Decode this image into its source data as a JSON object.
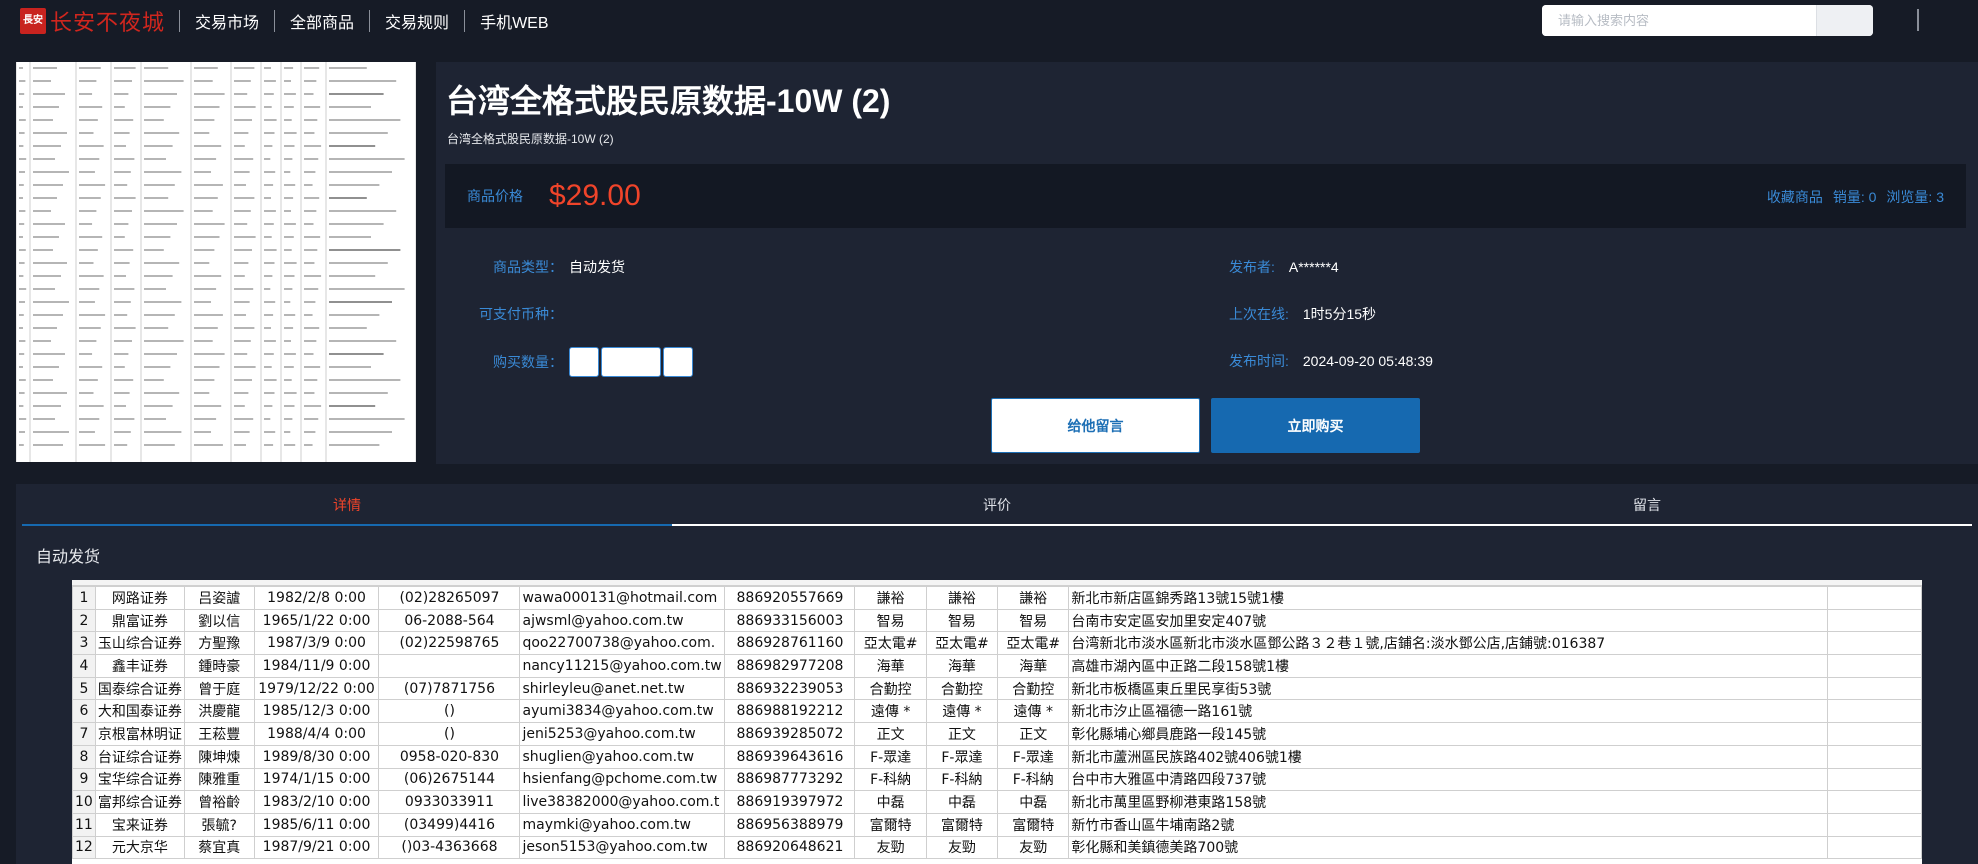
{
  "nav": {
    "logo_mark": "長安",
    "logo_text": "长安不夜城",
    "links": [
      "交易市场",
      "全部商品",
      "交易规则",
      "手机WEB"
    ],
    "search_placeholder": "请输入搜索内容"
  },
  "product": {
    "title": "台湾全格式股民原数据-10W (2)",
    "subtitle": "台湾全格式股民原数据-10W (2)",
    "price_label": "商品价格",
    "price": "$29.00",
    "fav_label": "收藏商品",
    "sales": "销量: 0",
    "views": "浏览量: 3",
    "type_label": "商品类型：",
    "type_value": "自动发货",
    "currency_label": "可支付币种：",
    "qty_label": "购买数量：",
    "publisher_label": "发布者:",
    "publisher_value": "A******4",
    "online_label": "上次在线:",
    "online_value": "1时5分15秒",
    "time_label": "发布时间:",
    "time_value": "2024-09-20 05:48:39",
    "msg_button": "给他留言",
    "buy_button": "立即购买"
  },
  "tabs": [
    "详情",
    "评价",
    "留言"
  ],
  "detail": {
    "section_title": "自动发货",
    "rows": [
      [
        "1",
        "网路证券",
        "吕姿謯",
        "1982/2/8 0:00",
        "(02)28265097",
        "wawa000131@hotmail.com",
        "886920557669",
        "謙裕",
        "謙裕",
        "謙裕",
        "新北市新店區錦秀路13號15號1樓"
      ],
      [
        "2",
        "鼎富证券",
        "劉以信",
        "1965/1/22 0:00",
        "06-2088-564",
        "ajwsml@yahoo.com.tw",
        "886933156003",
        "智易",
        "智易",
        "智易",
        "台南市安定區安加里安定407號"
      ],
      [
        "3",
        "玉山综合证券",
        "方聖豫",
        "1987/3/9 0:00",
        "(02)22598765",
        "qoo22700738@yahoo.com.",
        "886928761160",
        "亞太電#",
        "亞太電#",
        "亞太電#",
        "台湾新北市淡水區新北市淡水區鄧公路３２巷１號,店鋪名:淡水鄧公店,店鋪號:016387"
      ],
      [
        "4",
        "鑫丰证券",
        "鍾時豪",
        "1984/11/9 0:00",
        "",
        "nancy11215@yahoo.com.tw",
        "886982977208",
        "海華",
        "海華",
        "海華",
        "高雄市湖內區中正路二段158號1樓"
      ],
      [
        "5",
        "国泰综合证券",
        "曾于庭",
        "1979/12/22 0:00",
        "(07)7871756",
        "shirleyleu@anet.net.tw",
        "886932239053",
        "合勤控",
        "合勤控",
        "合勤控",
        "新北市板橋區東丘里民享街53號"
      ],
      [
        "6",
        "大和国泰证券",
        "洪慶龍",
        "1985/12/3 0:00",
        "()",
        "ayumi3834@yahoo.com.tw",
        "886988192212",
        "遠傳 *",
        "遠傳 *",
        "遠傳 *",
        "新北市汐止區福德一路161號"
      ],
      [
        "7",
        "京根富林明证",
        "王菘豐",
        "1988/4/4 0:00",
        "()",
        "jeni5253@yahoo.com.tw",
        "886939285072",
        "正文",
        "正文",
        "正文",
        "彰化縣埔心鄉員鹿路一段145號"
      ],
      [
        "8",
        "台证综合证券",
        "陳坤煉",
        "1989/8/30 0:00",
        "0958-020-830",
        "shuglien@yahoo.com.tw",
        "886939643616",
        "F-眾達",
        "F-眾達",
        "F-眾達",
        "新北市蘆洲區民族路402號406號1樓"
      ],
      [
        "9",
        "宝华综合证券",
        "陳雅重",
        "1974/1/15 0:00",
        "(06)2675144",
        "hsienfang@pchome.com.tw",
        "886987773292",
        "F-科納",
        "F-科納",
        "F-科納",
        "台中市大雅區中清路四段737號"
      ],
      [
        "10",
        "富邦综合证券",
        "曾裕齡",
        "1983/2/10 0:00",
        "0933033911",
        "live38382000@yahoo.com.t",
        "886919397972",
        "中磊",
        "中磊",
        "中磊",
        "新北市萬里區野柳港東路158號"
      ],
      [
        "11",
        "宝来证券",
        "張毓?",
        "1985/6/11 0:00",
        "(03499)4416",
        "maymki@yahoo.com.tw",
        "886956388979",
        "富爾特",
        "富爾特",
        "富爾特",
        "新竹市香山區牛埔南路2號"
      ],
      [
        "12",
        "元大京华",
        "蔡宜真",
        "1987/9/21 0:00",
        "()03-4363668",
        "jeson5153@yahoo.com.tw",
        "886920648621",
        "友勁",
        "友勁",
        "友勁",
        "彰化縣和美鎮德美路700號"
      ]
    ]
  }
}
